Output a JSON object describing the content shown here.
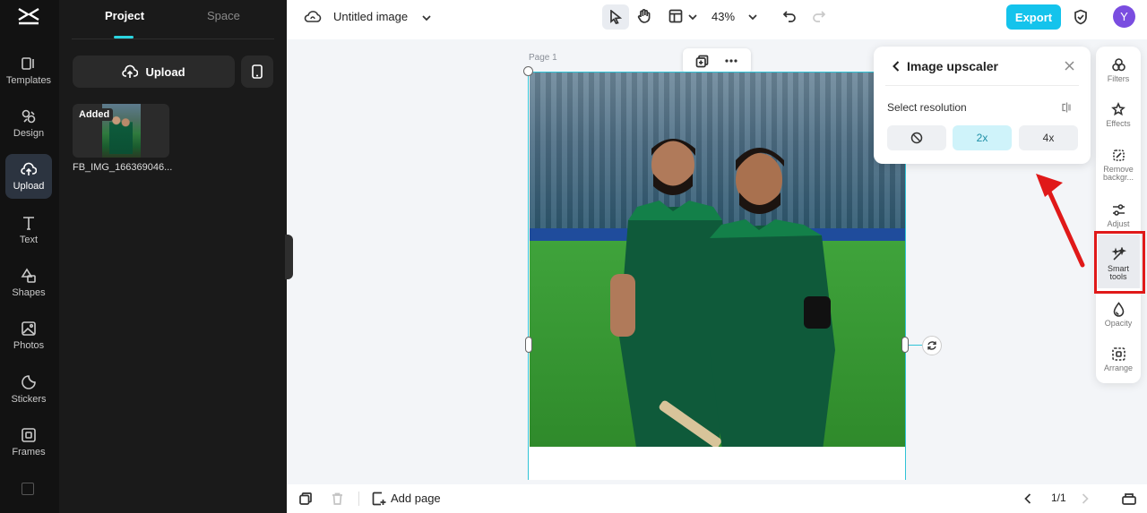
{
  "rail": {
    "items": [
      {
        "label": "Templates",
        "icon": "templates-icon"
      },
      {
        "label": "Design",
        "icon": "design-icon"
      },
      {
        "label": "Upload",
        "icon": "upload-cloud-icon"
      },
      {
        "label": "Text",
        "icon": "text-icon"
      },
      {
        "label": "Shapes",
        "icon": "shapes-icon"
      },
      {
        "label": "Photos",
        "icon": "photos-icon"
      },
      {
        "label": "Stickers",
        "icon": "stickers-icon"
      },
      {
        "label": "Frames",
        "icon": "frames-icon"
      }
    ],
    "active": "Upload"
  },
  "panel": {
    "tabs": [
      "Project",
      "Space"
    ],
    "active_tab": "Project",
    "upload_label": "Upload",
    "file": {
      "badge": "Added",
      "name": "FB_IMG_166369046..."
    }
  },
  "topbar": {
    "title": "Untitled image",
    "zoom": "43%",
    "export_label": "Export",
    "avatar_letter": "Y"
  },
  "canvas": {
    "page_label": "Page 1"
  },
  "upscaler": {
    "title": "Image upscaler",
    "select_label": "Select resolution",
    "options": [
      "2x",
      "4x"
    ],
    "selected": "2x"
  },
  "right_tools": [
    {
      "label": "Filters",
      "icon": "filters-icon"
    },
    {
      "label": "Effects",
      "icon": "effects-icon"
    },
    {
      "label": "Remove\nbackgr...",
      "icon": "remove-background-icon"
    },
    {
      "label": "Adjust",
      "icon": "adjust-icon"
    },
    {
      "label": "Smart\ntools",
      "icon": "smart-tools-icon"
    },
    {
      "label": "Opacity",
      "icon": "opacity-icon"
    },
    {
      "label": "Arrange",
      "icon": "arrange-icon"
    }
  ],
  "bottombar": {
    "add_page_label": "Add page",
    "pager": "1/1"
  },
  "colors": {
    "accent": "#14c3ec",
    "highlight": "#e01919",
    "selection": "#30c3d6"
  }
}
